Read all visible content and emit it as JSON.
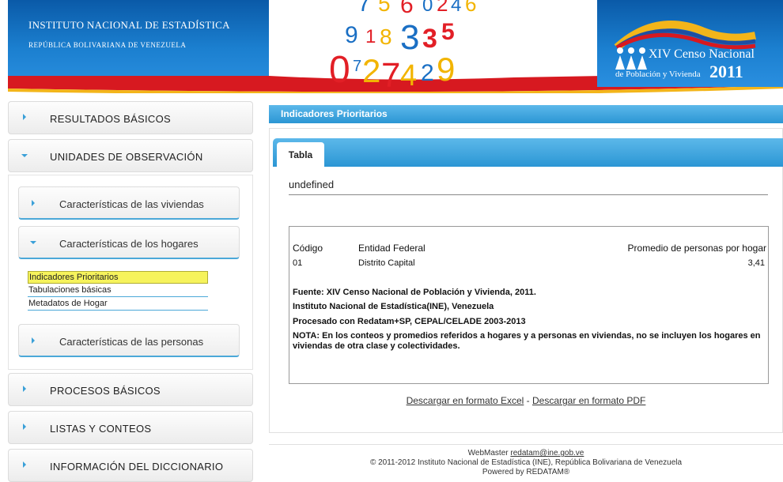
{
  "header": {
    "logo_line1": "INSTITUTO NACIONAL DE ESTADÍSTICA",
    "logo_line2": "REPÚBLICA BOLIVARIANA DE VENEZUELA",
    "census_title": "XIV Censo Nacional",
    "census_sub": "de Población y Vivienda",
    "census_year": "2011",
    "digit_colors": [
      "#1a6fc4",
      "#f2b400",
      "#e21f26"
    ]
  },
  "sidebar": {
    "items": [
      {
        "label": "RESULTADOS BÁSICOS"
      },
      {
        "label": "UNIDADES DE OBSERVACIÓN"
      },
      {
        "label": "PROCESOS BÁSICOS"
      },
      {
        "label": "LISTAS Y CONTEOS"
      },
      {
        "label": "INFORMACIÓN DEL DICCIONARIO"
      }
    ],
    "sub_items": [
      {
        "label": "Características de las viviendas"
      },
      {
        "label": "Características de los hogares"
      },
      {
        "label": "Características de las personas"
      }
    ],
    "leaves": [
      {
        "label": "Indicadores Prioritarios"
      },
      {
        "label": "Tabulaciones básicas"
      },
      {
        "label": "Metadatos de Hogar"
      }
    ]
  },
  "main": {
    "title": "Indicadores Prioritarios",
    "tab": "Tabla",
    "subtitle": "undefined",
    "table": {
      "headers": [
        "Código",
        "Entidad Federal",
        "Promedio de personas por hogar"
      ],
      "rows": [
        [
          "01",
          "Distrito Capital",
          "3,41"
        ]
      ]
    },
    "notes": [
      "Fuente: XIV Censo Nacional de Población y Vivienda, 2011.",
      "Instituto Nacional de Estadística(INE), Venezuela",
      "Procesado con Redatam+SP, CEPAL/CELADE 2003-2013",
      "NOTA: En los conteos y promedios referidos a hogares y a personas en viviendas, no se incluyen los hogares en viviendas de otra clase y colectividades."
    ],
    "download_excel": "Descargar en formato Excel",
    "download_sep": " - ",
    "download_pdf": "Descargar en formato PDF"
  },
  "footer": {
    "webmaster_label": "WebMaster",
    "webmaster_email": "redatam@ine.gob.ve",
    "copyright": "© 2011-2012 Instituto Nacional de Estadística (INE), República Bolivariana de Venezuela",
    "powered": "Powered by REDATAM®"
  }
}
